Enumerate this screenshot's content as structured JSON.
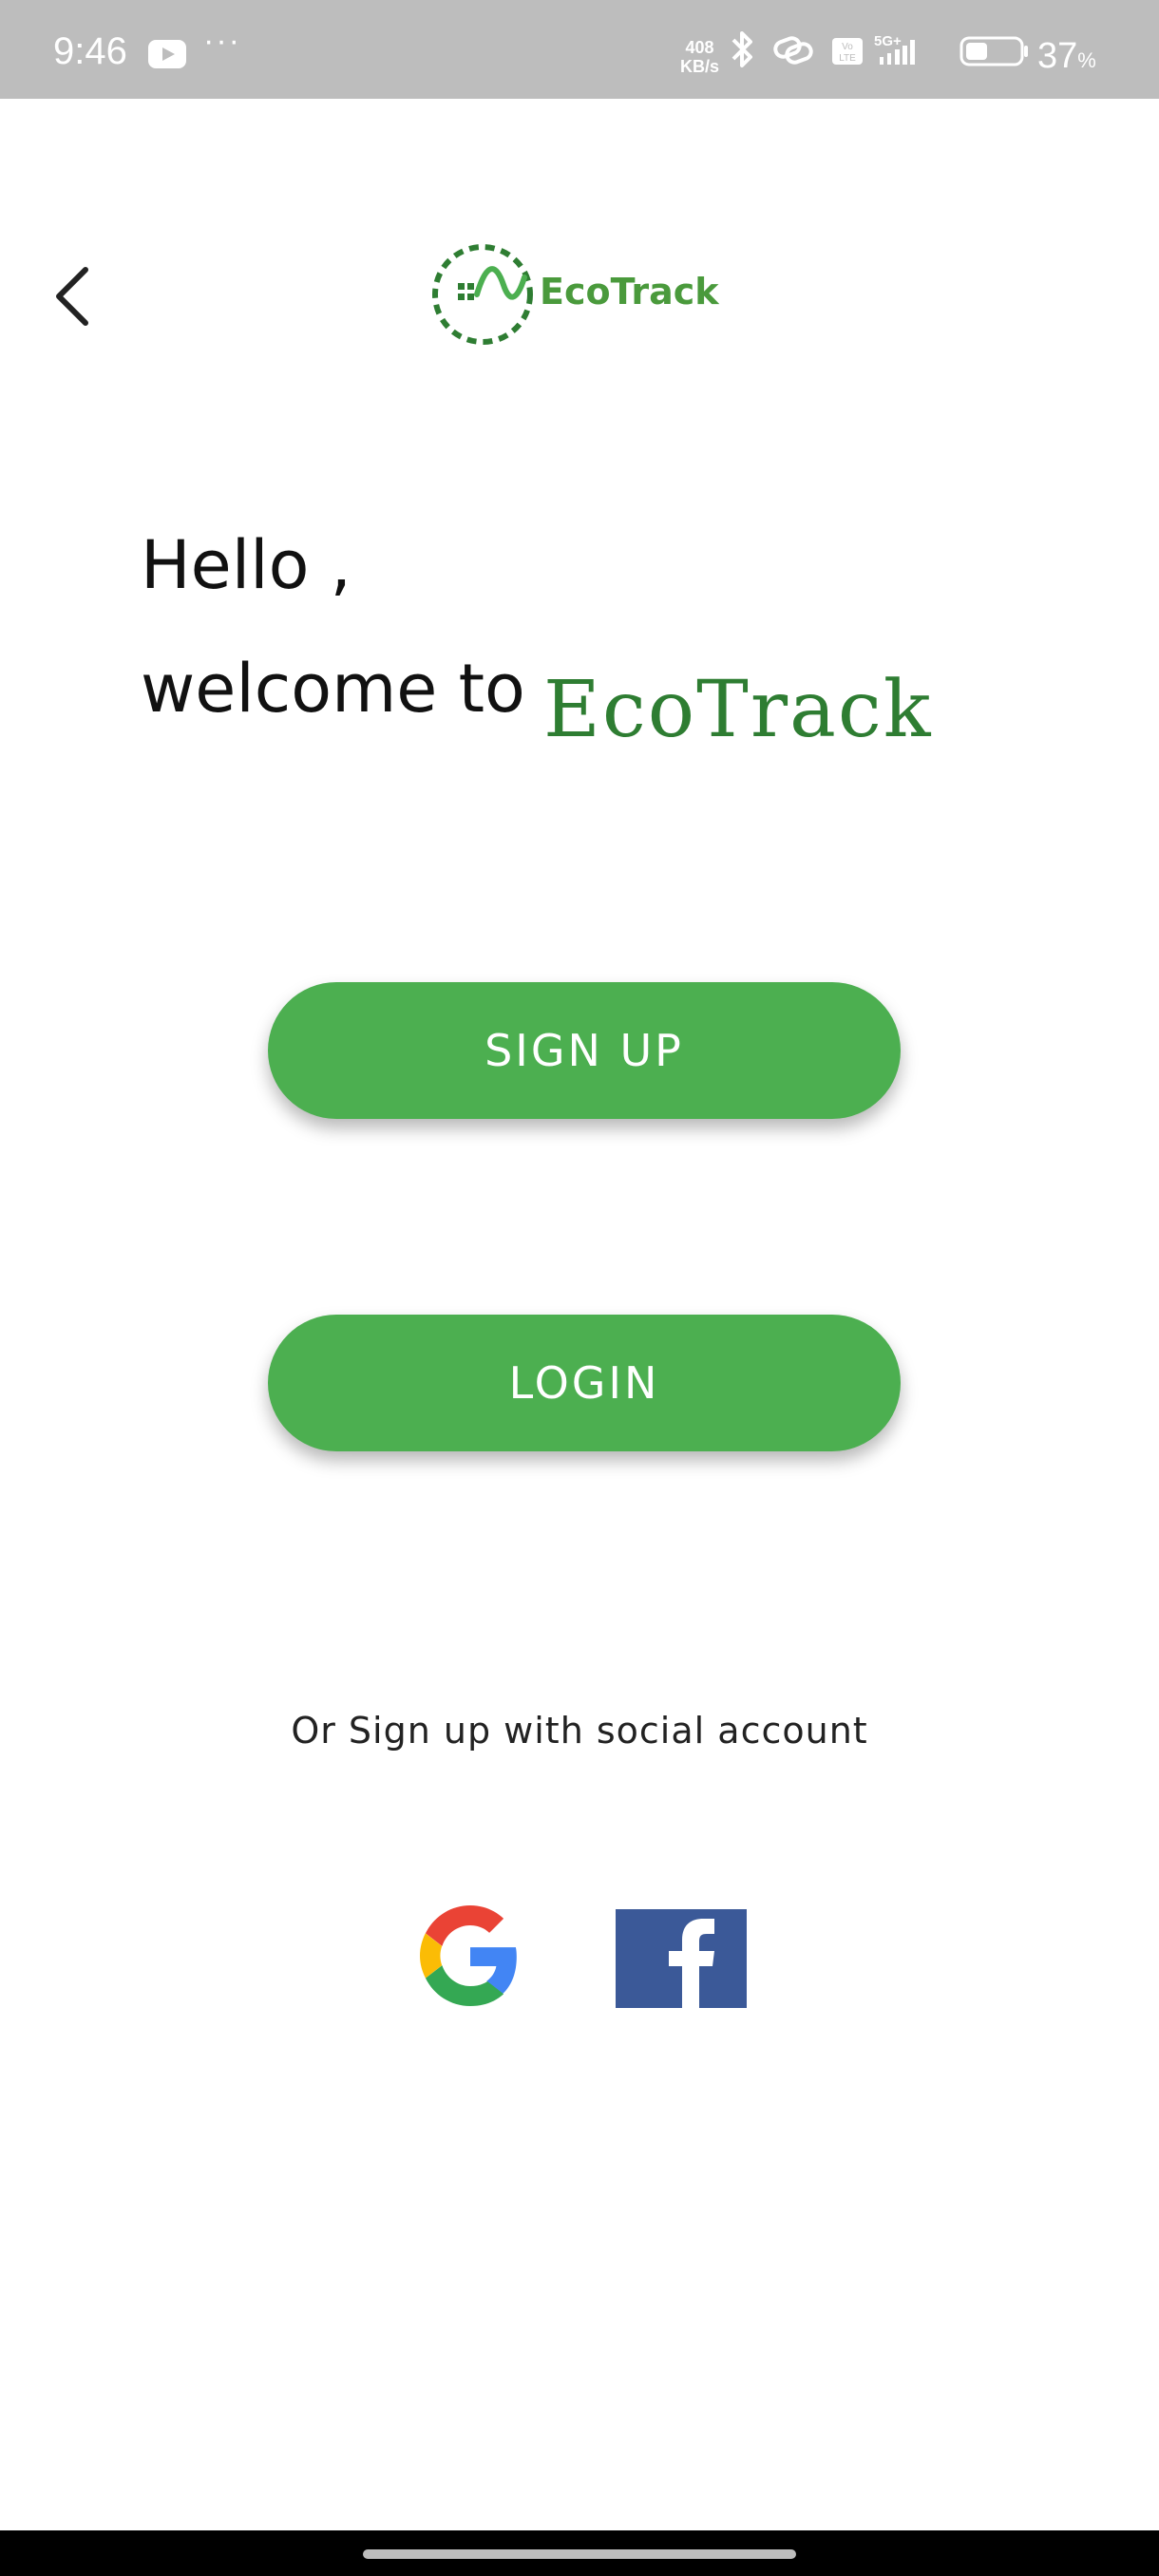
{
  "status_bar": {
    "time": "9:46",
    "youtube_icon": "youtube-icon",
    "more": "···",
    "speed_value": "408",
    "speed_unit": "KB/s",
    "battery_value": "37",
    "battery_unit": "%",
    "icons": [
      "bluetooth-icon",
      "link-icon",
      "volte-icon",
      "signal-5g-icon",
      "battery-icon"
    ]
  },
  "header": {
    "back_icon": "chevron-left-icon",
    "logo_text": "EcoTrack"
  },
  "greeting": {
    "line1": "Hello ,",
    "line2": "welcome to",
    "brand": "EcoTrack"
  },
  "buttons": {
    "signup": "SIGN UP",
    "login": "LOGIN"
  },
  "social": {
    "caption": "Or Sign up with social account",
    "providers": [
      "google-icon",
      "facebook-icon"
    ]
  },
  "colors": {
    "accent": "#4caf50",
    "brand_text": "#2e7d32",
    "status_bar": "#bdbdbd",
    "facebook": "#3b5998"
  }
}
